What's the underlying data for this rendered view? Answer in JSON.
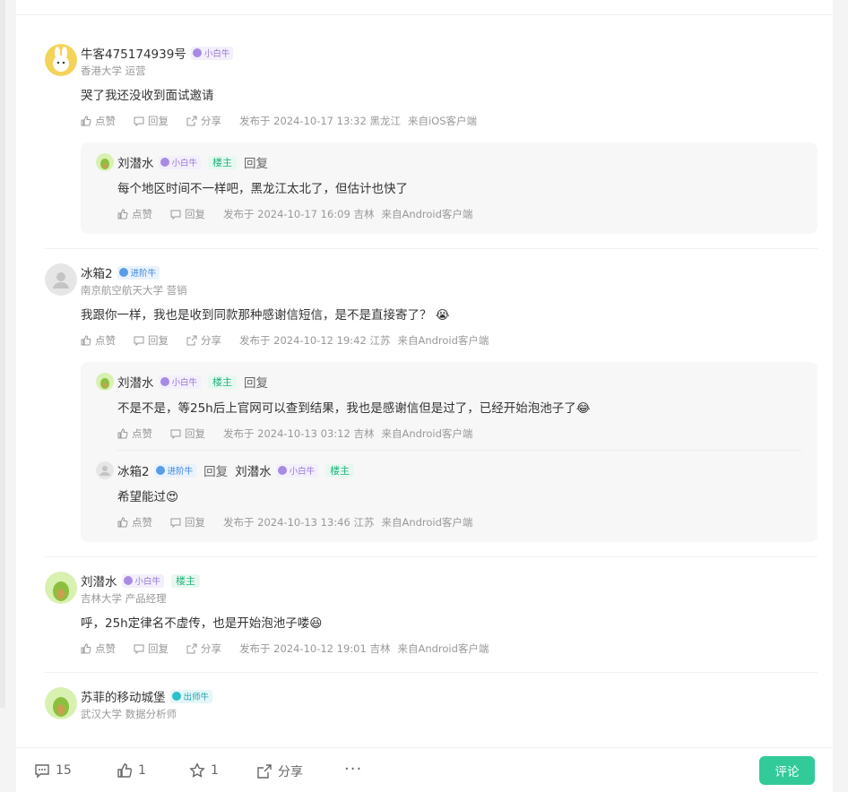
{
  "comments": [
    {
      "name": "牛客475174939号",
      "badge": "小白牛",
      "school": "香港大学 运营",
      "text": "哭了我还没收到面试邀请",
      "like": "点赞",
      "reply": "回复",
      "share": "分享",
      "time": "发布于 2024-10-17 13:32 黑龙江",
      "source": "来自iOS客户端",
      "replies": [
        {
          "name": "刘潜水",
          "badge": "小白牛",
          "lz": "楼主",
          "reply_word": "回复",
          "text": "每个地区时间不一样吧，黑龙江太北了，但估计也快了",
          "like": "点赞",
          "reply": "回复",
          "time": "发布于 2024-10-17 16:09 吉林",
          "source": "来自Android客户端"
        }
      ]
    },
    {
      "name": "冰箱2",
      "badge": "进阶牛",
      "school": "南京航空航天大学 营销",
      "text": "我跟你一样，我也是收到同款那种感谢信短信，是不是直接寄了？",
      "like": "点赞",
      "reply": "回复",
      "share": "分享",
      "time": "发布于 2024-10-12 19:42 江苏",
      "source": "来自Android客户端",
      "replies": [
        {
          "name": "刘潜水",
          "badge": "小白牛",
          "lz": "楼主",
          "reply_word": "回复",
          "text": "不是不是，等25h后上官网可以查到结果，我也是感谢信但是过了，已经开始泡池子了",
          "like": "点赞",
          "reply": "回复",
          "time": "发布于 2024-10-13 03:12 吉林",
          "source": "来自Android客户端"
        },
        {
          "name": "冰箱2",
          "badge": "进阶牛",
          "reply_word": "回复",
          "target_name": "刘潜水",
          "target_badge": "小白牛",
          "target_lz": "楼主",
          "text": "希望能过",
          "like": "点赞",
          "reply": "回复",
          "time": "发布于 2024-10-13 13:46 江苏",
          "source": "来自Android客户端"
        }
      ]
    },
    {
      "name": "刘潜水",
      "badge": "小白牛",
      "lz": "楼主",
      "school": "吉林大学 产品经理",
      "text": "呼，25h定律名不虚传，也是开始泡池子喽",
      "like": "点赞",
      "reply": "回复",
      "share": "分享",
      "time": "发布于 2024-10-12 19:01 吉林",
      "source": "来自Android客户端"
    },
    {
      "name": "苏菲的移动城堡",
      "badge": "出师牛",
      "school": "武汉大学 数据分析师"
    }
  ],
  "bottom_bar": {
    "comments": "15",
    "likes": "1",
    "favorites": "1",
    "share": "分享",
    "comment_button": "评论"
  },
  "icons": {
    "like": "thumbs-up-icon",
    "reply": "chat-bubble-icon",
    "share": "share-icon",
    "more": "more-dots-icon",
    "star": "star-icon"
  },
  "colors": {
    "accent": "#32ca99",
    "lz": "#1fb37c"
  }
}
